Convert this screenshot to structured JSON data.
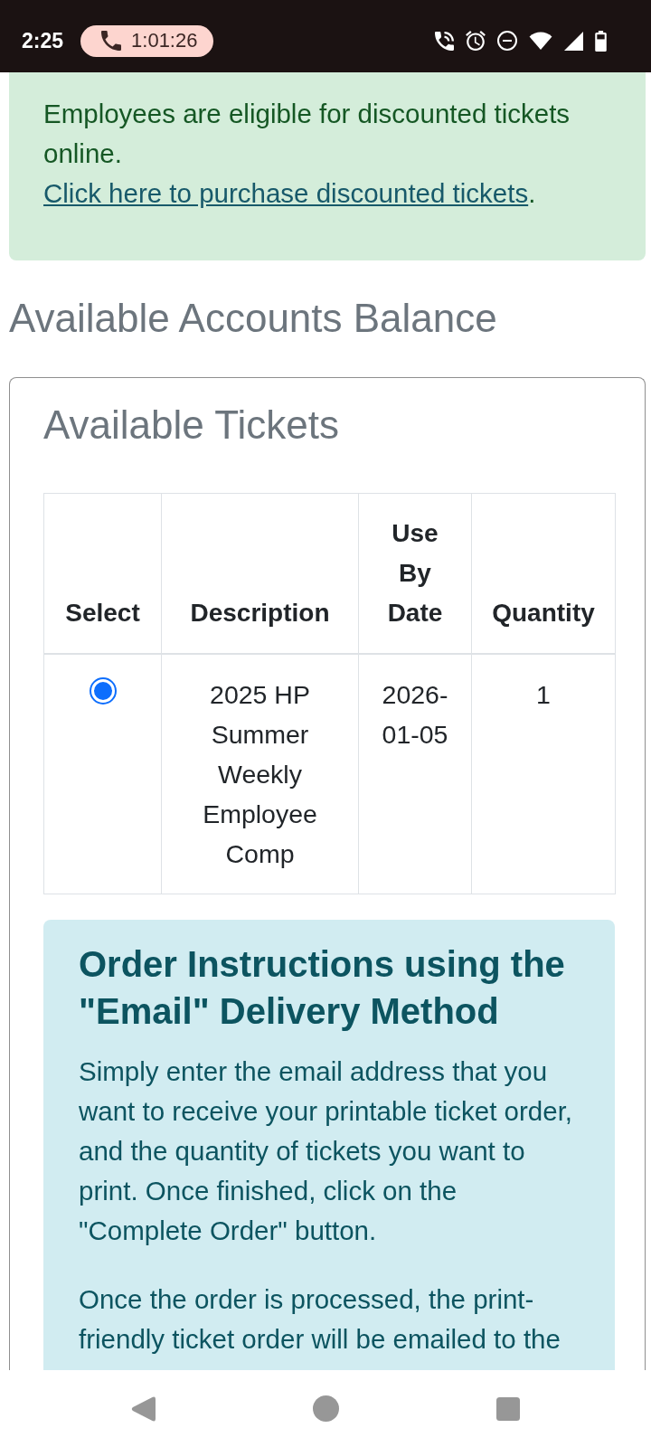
{
  "status_bar": {
    "time": "2:25",
    "call_timer": "1:01:26"
  },
  "alert": {
    "text": "Employees are eligible for discounted tickets online.",
    "link": "Click here to purchase discounted tickets",
    "after_link": "."
  },
  "heading": "Available Accounts Balance",
  "card": {
    "title": "Available Tickets",
    "table": {
      "columns": [
        "Select",
        "Description",
        "Use By Date",
        "Quantity"
      ],
      "rows": [
        {
          "selected": true,
          "description": "2025 HP Summer Weekly Employee Comp",
          "use_by_date": "2026-01-05",
          "quantity": "1"
        }
      ]
    },
    "instructions": {
      "title": "Order Instructions using the \"Email\" Delivery Method",
      "paragraphs": [
        "Simply enter the email address that you want to receive your printable ticket order, and the quantity of tickets you want to print. Once finished, click on the \"Complete Order\" button.",
        "Once the order is processed, the print-friendly ticket order will be emailed to the"
      ]
    }
  }
}
